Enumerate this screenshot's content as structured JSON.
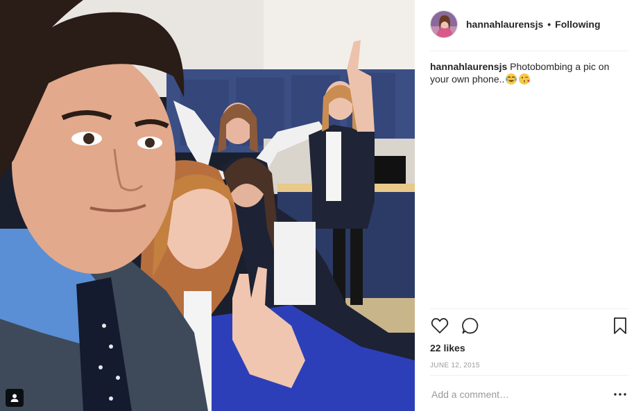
{
  "post": {
    "username": "hannahlaurensjs",
    "separator": "•",
    "follow_status": "Following",
    "caption_user": "hannahlaurensjs",
    "caption_text": "Photobombing a pic on your own phone..",
    "caption_emojis": [
      "tears-of-joy-emoji",
      "kissing-face-emoji"
    ],
    "likes": "22 likes",
    "date": "JUNE 12, 2015",
    "comment_placeholder": "Add a comment…",
    "icons": {
      "like": "heart-icon",
      "comment": "speech-bubble-icon",
      "save": "bookmark-icon",
      "more": "ellipsis-icon",
      "tagged": "user-tag-icon"
    },
    "colors": {
      "text": "#262626",
      "muted": "#999999",
      "divider": "#efefef"
    }
  }
}
